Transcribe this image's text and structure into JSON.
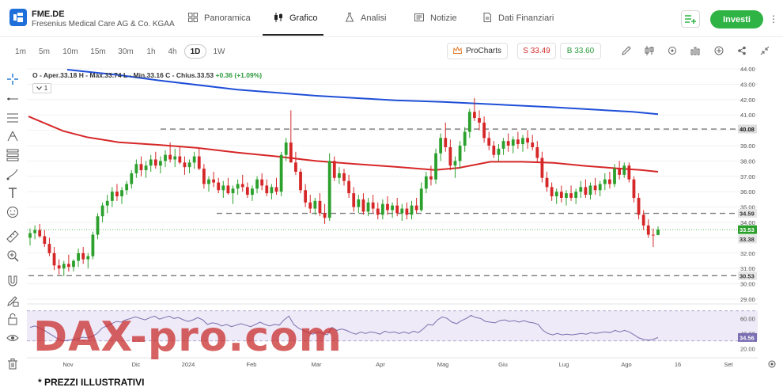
{
  "header": {
    "symbol": "FME.DE",
    "instrument_name": "Fresenius Medical Care AG & Co. KGAA",
    "tabs": [
      {
        "label": "Panoramica",
        "icon": "grid-icon"
      },
      {
        "label": "Grafico",
        "icon": "candles-icon",
        "active": true
      },
      {
        "label": "Analisi",
        "icon": "flask-icon"
      },
      {
        "label": "Notizie",
        "icon": "news-icon"
      },
      {
        "label": "Dati Finanziari",
        "icon": "document-icon"
      }
    ],
    "invest_label": "Investi"
  },
  "toolbar": {
    "timeframes": [
      "1m",
      "5m",
      "10m",
      "15m",
      "30m",
      "1h",
      "4h",
      "1D",
      "1W"
    ],
    "selected_timeframe": "1D",
    "procharts_label": "ProCharts",
    "sell_label": "S 33.49",
    "buy_label": "B 33.60",
    "right_icons": [
      "pencil-icon",
      "candles-icon",
      "indicator-icon",
      "bars-icon",
      "add-icon",
      "share-icon",
      "collapse-icon"
    ]
  },
  "legend": {
    "text": "O - Aper.33.18  H - Max.33.74  L - Min.33.16  C - Chius.33.53",
    "change": "+0.36 (+1.09%)",
    "toggle": "1"
  },
  "left_tools": [
    "crosshair-icon",
    "horizontal-line-icon",
    "parallel-channel-icon",
    "pitchfork-icon",
    "pattern-icon",
    "brush-icon",
    "text-icon",
    "emoji-icon",
    "ruler-icon",
    "zoom-in-icon",
    "magnet-icon",
    "lock-pencil-icon",
    "lock-icon",
    "eye-icon",
    "trash-icon"
  ],
  "colors": {
    "up": "#2ca02c",
    "down": "#d62728",
    "ma_long": "#1f4fd8",
    "ma_mid": "#d62728",
    "rsi_line": "#7a6fb0",
    "rsi_band": "#efeaf7",
    "accent_green": "#2fb344"
  },
  "chart_data": {
    "type": "candlestick",
    "y_ticks": [
      "44.00",
      "43.00",
      "42.00",
      "41.00",
      "40.00",
      "39.00",
      "38.00",
      "37.00",
      "36.00",
      "35.00",
      "34.00",
      "33.00",
      "32.00",
      "31.00",
      "30.00",
      "29.00"
    ],
    "ylim": [
      28.5,
      44.2
    ],
    "x_labels": [
      "Nov",
      "Dic",
      "2024",
      "Feb",
      "Mar",
      "Apr",
      "Mag",
      "Giu",
      "Lug",
      "Ago",
      "16",
      "Set"
    ],
    "price_tags": [
      {
        "value": "40.08",
        "style": "dark"
      },
      {
        "value": "34.59",
        "style": "light"
      },
      {
        "value": "33.53",
        "style": "green"
      },
      {
        "value": "33.38",
        "style": "light"
      },
      {
        "value": "30.53",
        "style": "light"
      }
    ],
    "horizontal_levels": [
      40.08,
      34.59,
      30.53
    ],
    "candles": [
      [
        33.0,
        33.6,
        32.5,
        33.3
      ],
      [
        33.3,
        33.8,
        32.9,
        33.5
      ],
      [
        33.5,
        33.9,
        33.0,
        33.1
      ],
      [
        33.1,
        33.5,
        32.4,
        32.6
      ],
      [
        32.6,
        33.0,
        31.8,
        32.0
      ],
      [
        32.0,
        32.4,
        30.9,
        31.2
      ],
      [
        31.2,
        31.6,
        30.6,
        31.0
      ],
      [
        31.0,
        31.5,
        30.5,
        31.3
      ],
      [
        31.3,
        31.9,
        30.8,
        31.1
      ],
      [
        31.1,
        31.6,
        30.8,
        31.5
      ],
      [
        31.5,
        32.3,
        31.1,
        32.0
      ],
      [
        32.0,
        32.4,
        31.3,
        31.6
      ],
      [
        31.6,
        32.0,
        31.0,
        31.8
      ],
      [
        31.8,
        33.4,
        31.6,
        33.2
      ],
      [
        33.2,
        34.6,
        32.9,
        34.4
      ],
      [
        34.4,
        35.3,
        34.0,
        35.1
      ],
      [
        35.1,
        35.8,
        34.6,
        35.4
      ],
      [
        35.4,
        36.3,
        35.0,
        36.0
      ],
      [
        36.0,
        36.5,
        35.4,
        35.7
      ],
      [
        35.7,
        36.3,
        35.2,
        36.1
      ],
      [
        36.1,
        36.7,
        35.8,
        36.5
      ],
      [
        36.5,
        37.4,
        36.2,
        37.2
      ],
      [
        37.2,
        38.1,
        36.9,
        37.8
      ],
      [
        37.8,
        38.3,
        37.0,
        37.4
      ],
      [
        37.4,
        38.0,
        36.9,
        37.7
      ],
      [
        37.7,
        38.4,
        37.3,
        38.1
      ],
      [
        38.1,
        38.6,
        37.5,
        37.7
      ],
      [
        37.7,
        38.3,
        37.2,
        38.0
      ],
      [
        38.0,
        38.7,
        37.6,
        38.4
      ],
      [
        38.4,
        39.2,
        37.9,
        38.1
      ],
      [
        38.1,
        38.8,
        37.6,
        38.3
      ],
      [
        38.3,
        38.9,
        37.8,
        37.9
      ],
      [
        37.9,
        38.3,
        37.1,
        37.6
      ],
      [
        37.6,
        38.1,
        37.2,
        37.9
      ],
      [
        37.9,
        38.6,
        37.5,
        38.3
      ],
      [
        38.3,
        38.8,
        37.4,
        37.5
      ],
      [
        37.5,
        37.8,
        36.2,
        36.5
      ],
      [
        36.5,
        37.0,
        36.0,
        36.8
      ],
      [
        36.8,
        37.3,
        36.3,
        36.6
      ],
      [
        36.6,
        36.9,
        35.9,
        36.1
      ],
      [
        36.1,
        36.7,
        35.6,
        36.4
      ],
      [
        36.4,
        36.9,
        35.8,
        35.9
      ],
      [
        35.9,
        36.4,
        35.2,
        36.2
      ],
      [
        36.2,
        36.8,
        35.8,
        36.5
      ],
      [
        36.5,
        37.1,
        36.0,
        36.3
      ],
      [
        36.3,
        36.6,
        35.6,
        35.8
      ],
      [
        35.8,
        36.4,
        35.4,
        36.2
      ],
      [
        36.2,
        37.0,
        35.9,
        36.8
      ],
      [
        36.8,
        37.2,
        36.1,
        36.4
      ],
      [
        36.4,
        36.8,
        35.7,
        35.9
      ],
      [
        35.9,
        36.5,
        35.5,
        36.3
      ],
      [
        36.3,
        36.9,
        35.8,
        36.0
      ],
      [
        36.0,
        38.6,
        35.7,
        38.4
      ],
      [
        38.4,
        39.5,
        38.0,
        39.2
      ],
      [
        39.2,
        41.3,
        38.5,
        37.9
      ],
      [
        37.9,
        38.6,
        37.1,
        37.3
      ],
      [
        37.3,
        37.5,
        35.9,
        36.1
      ],
      [
        36.1,
        36.5,
        35.0,
        35.3
      ],
      [
        35.3,
        35.8,
        34.6,
        34.9
      ],
      [
        34.9,
        35.6,
        34.5,
        35.4
      ],
      [
        35.4,
        35.9,
        34.4,
        34.6
      ],
      [
        34.6,
        35.2,
        33.9,
        34.3
      ],
      [
        34.3,
        38.5,
        34.1,
        38.0
      ],
      [
        38.0,
        38.3,
        36.7,
        36.9
      ],
      [
        36.9,
        37.6,
        36.5,
        37.2
      ],
      [
        37.2,
        37.5,
        36.4,
        36.7
      ],
      [
        36.7,
        37.1,
        35.6,
        35.9
      ],
      [
        35.9,
        36.3,
        34.7,
        35.0
      ],
      [
        35.0,
        35.8,
        34.6,
        35.5
      ],
      [
        35.5,
        35.9,
        34.5,
        34.7
      ],
      [
        34.7,
        35.6,
        34.4,
        35.3
      ],
      [
        35.3,
        35.8,
        34.6,
        34.9
      ],
      [
        34.9,
        35.3,
        34.2,
        34.5
      ],
      [
        34.5,
        35.5,
        34.2,
        35.2
      ],
      [
        35.2,
        35.7,
        34.5,
        34.8
      ],
      [
        34.8,
        35.3,
        34.3,
        35.1
      ],
      [
        35.1,
        35.6,
        34.4,
        34.6
      ],
      [
        34.6,
        35.2,
        34.1,
        34.9
      ],
      [
        34.9,
        35.3,
        34.2,
        34.5
      ],
      [
        34.5,
        35.4,
        34.2,
        35.1
      ],
      [
        35.1,
        35.6,
        34.6,
        34.8
      ],
      [
        34.8,
        36.6,
        34.7,
        36.2
      ],
      [
        36.2,
        37.3,
        35.9,
        37.0
      ],
      [
        37.0,
        37.7,
        36.4,
        36.8
      ],
      [
        36.8,
        38.8,
        36.5,
        38.5
      ],
      [
        38.5,
        39.8,
        38.0,
        39.5
      ],
      [
        39.5,
        40.5,
        38.6,
        38.9
      ],
      [
        38.9,
        39.4,
        37.4,
        37.7
      ],
      [
        37.7,
        38.3,
        36.9,
        38.0
      ],
      [
        38.0,
        39.3,
        37.5,
        39.0
      ],
      [
        39.0,
        40.2,
        38.6,
        39.9
      ],
      [
        39.9,
        41.4,
        39.5,
        41.2
      ],
      [
        41.2,
        42.1,
        40.6,
        40.8
      ],
      [
        40.8,
        41.3,
        40.0,
        40.5
      ],
      [
        40.5,
        40.9,
        39.2,
        39.5
      ],
      [
        39.5,
        39.9,
        38.7,
        39.0
      ],
      [
        39.0,
        39.3,
        38.2,
        38.4
      ],
      [
        38.4,
        39.1,
        38.0,
        38.8
      ],
      [
        38.8,
        39.5,
        38.4,
        39.3
      ],
      [
        39.3,
        39.8,
        38.6,
        39.0
      ],
      [
        39.0,
        39.6,
        38.5,
        39.4
      ],
      [
        39.4,
        39.9,
        38.8,
        39.1
      ],
      [
        39.1,
        39.7,
        38.6,
        39.5
      ],
      [
        39.5,
        40.0,
        38.8,
        39.2
      ],
      [
        39.2,
        39.7,
        38.7,
        38.9
      ],
      [
        38.9,
        39.3,
        37.9,
        38.2
      ],
      [
        38.2,
        38.6,
        36.6,
        36.9
      ],
      [
        36.9,
        37.3,
        36.0,
        36.3
      ],
      [
        36.3,
        36.6,
        35.4,
        35.7
      ],
      [
        35.7,
        36.2,
        35.2,
        36.0
      ],
      [
        36.0,
        36.4,
        35.3,
        35.6
      ],
      [
        35.6,
        36.1,
        35.1,
        35.9
      ],
      [
        35.9,
        36.4,
        35.4,
        35.6
      ],
      [
        35.6,
        36.2,
        35.2,
        36.0
      ],
      [
        36.0,
        36.7,
        35.6,
        36.3
      ],
      [
        36.3,
        36.8,
        35.6,
        35.8
      ],
      [
        35.8,
        36.6,
        35.5,
        36.4
      ],
      [
        36.4,
        36.9,
        35.8,
        36.1
      ],
      [
        36.1,
        36.7,
        35.7,
        36.5
      ],
      [
        36.5,
        37.2,
        36.1,
        36.8
      ],
      [
        36.8,
        37.3,
        36.2,
        36.5
      ],
      [
        36.5,
        37.8,
        36.3,
        37.5
      ],
      [
        37.5,
        38.0,
        36.8,
        37.1
      ],
      [
        37.1,
        37.9,
        36.9,
        37.7
      ],
      [
        37.7,
        37.9,
        36.6,
        36.8
      ],
      [
        36.8,
        37.0,
        35.3,
        35.6
      ],
      [
        35.6,
        35.9,
        34.2,
        34.5
      ],
      [
        34.5,
        34.8,
        33.5,
        33.8
      ],
      [
        33.8,
        34.2,
        33.0,
        33.2
      ],
      [
        33.2,
        33.6,
        32.4,
        33.18
      ],
      [
        33.18,
        33.74,
        33.16,
        33.53
      ]
    ],
    "ma_long_points": [
      [
        85,
        43.95
      ],
      [
        150,
        43.6
      ],
      [
        200,
        43.25
      ],
      [
        300,
        42.65
      ],
      [
        400,
        42.25
      ],
      [
        500,
        41.95
      ],
      [
        560,
        41.85
      ],
      [
        640,
        41.65
      ],
      [
        700,
        41.5
      ],
      [
        750,
        41.35
      ],
      [
        800,
        41.2
      ],
      [
        832,
        41.05
      ]
    ],
    "ma_mid_points": [
      [
        36,
        40.9
      ],
      [
        80,
        39.95
      ],
      [
        110,
        39.55
      ],
      [
        150,
        39.22
      ],
      [
        200,
        39.05
      ],
      [
        250,
        38.85
      ],
      [
        300,
        38.55
      ],
      [
        350,
        38.3
      ],
      [
        400,
        38.0
      ],
      [
        450,
        37.8
      ],
      [
        500,
        37.62
      ],
      [
        550,
        37.42
      ],
      [
        580,
        37.55
      ],
      [
        620,
        37.95
      ],
      [
        660,
        37.95
      ],
      [
        700,
        37.88
      ],
      [
        740,
        37.68
      ],
      [
        780,
        37.52
      ],
      [
        810,
        37.42
      ],
      [
        832,
        37.3
      ]
    ],
    "rsi": {
      "ticks": [
        "60.00",
        "40.00",
        "20.00"
      ],
      "levels": [
        70,
        30
      ],
      "current_tag": "34.56",
      "values": [
        48,
        50,
        47,
        44,
        40,
        36,
        32,
        30,
        31,
        32,
        33,
        35,
        34,
        36,
        40,
        47,
        50,
        53,
        56,
        55,
        58,
        60,
        62,
        60,
        58,
        61,
        63,
        59,
        61,
        63,
        60,
        61,
        58,
        56,
        58,
        61,
        58,
        52,
        54,
        53,
        50,
        52,
        49,
        51,
        53,
        51,
        49,
        52,
        55,
        52,
        50,
        52,
        51,
        58,
        63,
        52,
        47,
        44,
        41,
        39,
        42,
        40,
        38,
        48,
        44,
        46,
        44,
        41,
        39,
        42,
        40,
        42,
        41,
        39,
        43,
        41,
        42,
        40,
        42,
        40,
        43,
        41,
        46,
        52,
        51,
        58,
        62,
        60,
        55,
        53,
        57,
        60,
        64,
        61,
        60,
        56,
        55,
        54,
        57,
        58,
        56,
        57,
        55,
        57,
        55,
        54,
        52,
        44,
        40,
        38,
        40,
        38,
        39,
        38,
        39,
        40,
        39,
        41,
        40,
        41,
        42,
        41,
        44,
        42,
        44,
        42,
        38,
        34,
        32,
        31,
        32,
        34.56
      ]
    }
  },
  "watermark": "DAX-pro.com",
  "footnote": "* PREZZI ILLUSTRATIVI"
}
